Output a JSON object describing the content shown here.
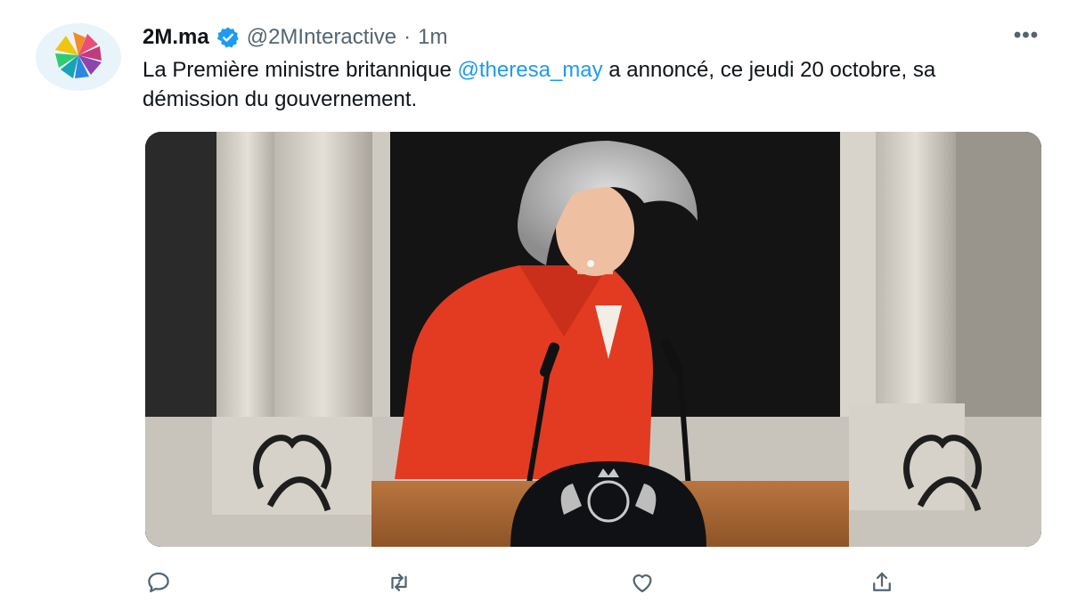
{
  "tweet": {
    "display_name": "2M.ma",
    "handle": "@2MInteractive",
    "separator": "·",
    "time": "1m",
    "more_label": "•••",
    "text_before": "La Première ministre britannique ",
    "mention": "@theresa_may",
    "text_after": " a annoncé, ce jeudi 20 octobre, sa démission du gouvernement."
  },
  "icons": {
    "avatar": "2m-logo-icon",
    "verified": "verified-badge-icon",
    "more": "more-options-icon",
    "reply": "reply-icon",
    "retweet": "retweet-icon",
    "like": "like-icon",
    "share": "share-icon"
  },
  "colors": {
    "accent": "#1d9bf0",
    "secondary_text": "#536471",
    "primary_text": "#0f1419"
  }
}
